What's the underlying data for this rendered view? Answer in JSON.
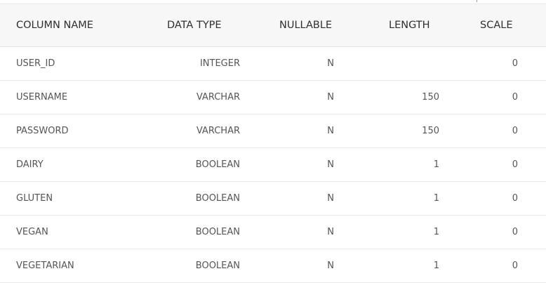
{
  "table": {
    "headers": [
      "COLUMN NAME",
      "DATA TYPE",
      "NULLABLE",
      "LENGTH",
      "SCALE"
    ],
    "rows": [
      {
        "name": "USER_ID",
        "type": "INTEGER",
        "nullable": "N",
        "length": "",
        "scale": "0"
      },
      {
        "name": "USERNAME",
        "type": "VARCHAR",
        "nullable": "N",
        "length": "150",
        "scale": "0"
      },
      {
        "name": "PASSWORD",
        "type": "VARCHAR",
        "nullable": "N",
        "length": "150",
        "scale": "0"
      },
      {
        "name": "DAIRY",
        "type": "BOOLEAN",
        "nullable": "N",
        "length": "1",
        "scale": "0"
      },
      {
        "name": "GLUTEN",
        "type": "BOOLEAN",
        "nullable": "N",
        "length": "1",
        "scale": "0"
      },
      {
        "name": "VEGAN",
        "type": "BOOLEAN",
        "nullable": "N",
        "length": "1",
        "scale": "0"
      },
      {
        "name": "VEGETARIAN",
        "type": "BOOLEAN",
        "nullable": "N",
        "length": "1",
        "scale": "0"
      }
    ]
  }
}
